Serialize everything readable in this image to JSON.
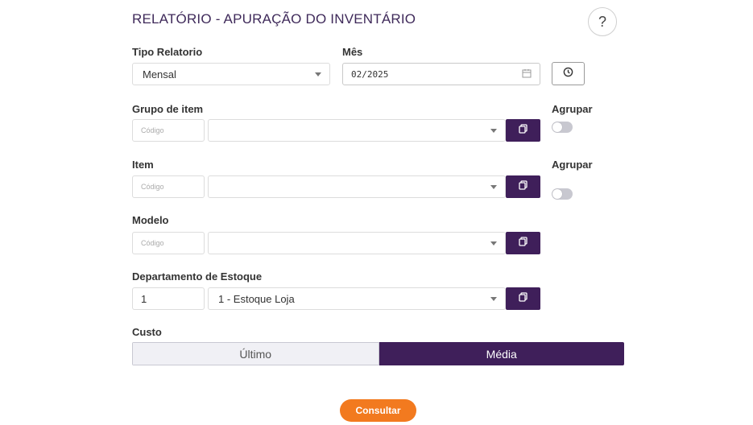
{
  "page": {
    "title": "RELATÓRIO - APURAÇÃO DO INVENTÁRIO",
    "help_label": "?"
  },
  "tipo_relatorio": {
    "label": "Tipo Relatorio",
    "value": "Mensal"
  },
  "mes": {
    "label": "Mês",
    "value": "02/2025"
  },
  "grupo_item": {
    "label": "Grupo de item",
    "code_placeholder": "Código",
    "select_value": "",
    "agrupar_label": "Agrupar"
  },
  "item": {
    "label": "Item",
    "code_placeholder": "Código",
    "select_value": "",
    "agrupar_label": "Agrupar"
  },
  "modelo": {
    "label": "Modelo",
    "code_placeholder": "Código",
    "select_value": ""
  },
  "departamento": {
    "label": "Departamento de Estoque",
    "code_value": "1",
    "select_value": "1 - Estoque Loja"
  },
  "custo": {
    "label": "Custo",
    "options": [
      "Último",
      "Média"
    ],
    "selected": "Média"
  },
  "actions": {
    "consultar_label": "Consultar"
  },
  "colors": {
    "primary": "#3f1f5a",
    "accent": "#f27a1f"
  }
}
